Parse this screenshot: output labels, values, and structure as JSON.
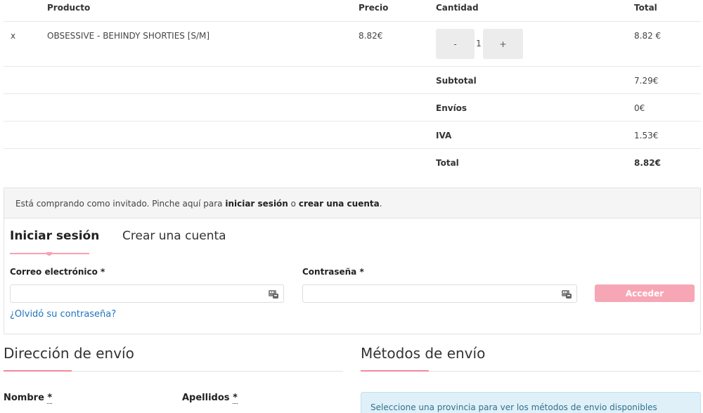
{
  "cart": {
    "headers": {
      "product": "Producto",
      "price": "Precio",
      "quantity": "Cantidad",
      "total": "Total"
    },
    "item": {
      "remove": "x",
      "product": "OBSESSIVE - BEHINDY SHORTIES [S/M]",
      "price": "8.82€",
      "qty_minus": "-",
      "qty_value": "1",
      "qty_plus": "+",
      "total": "8.82 €"
    },
    "totals": [
      {
        "label": "Subtotal",
        "value": "7.29€"
      },
      {
        "label": "Envíos",
        "value": "0€"
      },
      {
        "label": "IVA",
        "value": "1.53€"
      },
      {
        "label": "Total",
        "value": "8.82€"
      }
    ]
  },
  "login": {
    "notice_pre": "Está comprando como invitado. Pinche aquí para ",
    "notice_login": "iniciar sesión",
    "notice_mid": " o ",
    "notice_create": "crear una cuenta",
    "notice_post": ".",
    "tab_login": "Iniciar sesión",
    "tab_create": "Crear una cuenta",
    "email_label": "Correo electrónico *",
    "password_label": "Contraseña *",
    "submit": "Acceder",
    "forgot": "¿Olvidó su contraseña?"
  },
  "shipping_address": {
    "title": "Dirección de envío",
    "name_label": "Nombre",
    "surname_label": "Apellidos",
    "required_mark": "*"
  },
  "shipping_methods": {
    "title": "Métodos de envío",
    "info": "Seleccione una provincia para ver los métodos de envio disponibles"
  },
  "colors": {
    "accent": "#f7a6b5",
    "link": "#1e73be",
    "info_bg": "#dff0f8"
  }
}
